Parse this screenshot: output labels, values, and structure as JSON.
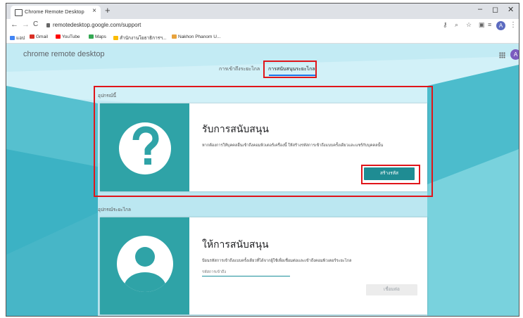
{
  "browser": {
    "tab_title": "Chrome Remote Desktop",
    "tab_close": "×",
    "new_tab": "+",
    "nav_back": "←",
    "nav_forward": "→",
    "nav_reload": "C",
    "url": "remotedesktop.google.com/support",
    "profile_initial": "A",
    "window_controls": {
      "minimize": "–",
      "maximize": "◻",
      "close": "✕"
    }
  },
  "bookmarks": [
    {
      "label": "แอป",
      "icon_color": "#4285f4"
    },
    {
      "label": "Gmail",
      "icon_color": "#d93025"
    },
    {
      "label": "YouTube",
      "icon_color": "#ff0000"
    },
    {
      "label": "Maps",
      "icon_color": "#34a853"
    },
    {
      "label": "สำนักงานโยธาธิการฯ...",
      "icon_color": "#fbbc04"
    },
    {
      "label": "Nakhon Phanom U...",
      "icon_color": "#e8a33d"
    }
  ],
  "app": {
    "brand": "chrome remote desktop",
    "avatar_initial": "A",
    "tabs": [
      {
        "label": "การเข้าถึงระยะไกล",
        "active": false
      },
      {
        "label": "การสนับสนุนระยะไกล",
        "active": true
      }
    ]
  },
  "sections": {
    "this_device": {
      "label": "อุปกรณ์นี้",
      "card": {
        "icon": "question-mark-icon",
        "heading": "รับการสนับสนุน",
        "description": "หากต้องการให้บุคคลอื่นเข้าถึงคอมพิวเตอร์เครื่องนี้ ให้สร้างรหัสการเข้าถึงแบบครั้งเดียวและแชร์กับบุคคลนั้น",
        "button": "สร้างรหัส"
      }
    },
    "remote_devices": {
      "label": "อุปกรณ์ระยะไกล",
      "card": {
        "icon": "person-avatar-icon",
        "heading": "ให้การสนับสนุน",
        "description": "ป้อนรหัสการเข้าถึงแบบครั้งเดียวที่ได้จากผู้ใช้เพื่อเชื่อมต่อและเข้าถึงคอมพิวเตอร์ระยะไกล",
        "input_placeholder": "รหัสการเข้าถึง",
        "button": "เชื่อมต่อ"
      }
    }
  },
  "colors": {
    "teal": "#2fa3a7",
    "button_teal": "#1f8c93",
    "highlight_red": "#e0151a",
    "page_bg": "#bfe9f3"
  }
}
